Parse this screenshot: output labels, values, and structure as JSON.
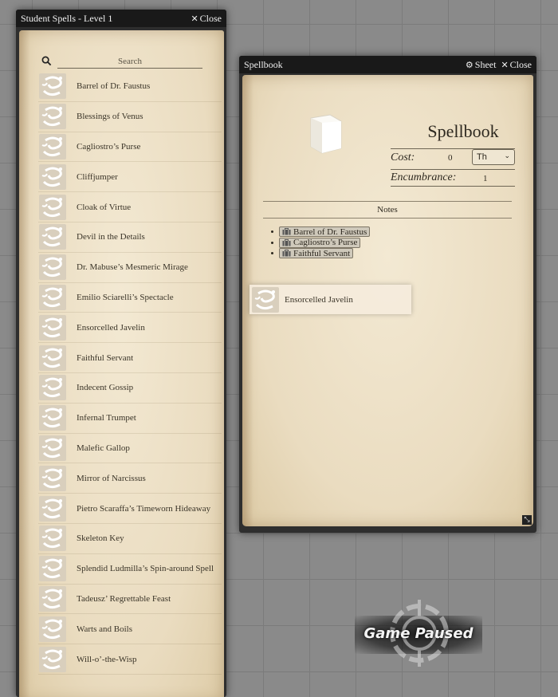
{
  "spells_window": {
    "title": "Student Spells - Level 1",
    "close_label": "Close",
    "search_placeholder": "Search",
    "spells": [
      "Barrel of Dr. Faustus",
      "Blessings of Venus",
      "Cagliostro’s Purse",
      "Cliffjumper",
      "Cloak of Virtue",
      "Devil in the Details",
      "Dr. Mabuse’s Mesmeric Mirage",
      "Emilio Sciarelli’s Spectacle",
      "Ensorcelled Javelin",
      "Faithful Servant",
      "Indecent Gossip",
      "Infernal Trumpet",
      "Malefic Gallop",
      "Mirror of Narcissus",
      "Pietro Scaraffa’s Timeworn Hideaway",
      "Skeleton Key",
      "Splendid Ludmilla’s Spin-around Spell",
      "Tadeusz’ Regrettable Feast",
      "Warts and Boils",
      "Will-o’-the-Wisp"
    ]
  },
  "spellbook_window": {
    "title": "Spellbook",
    "sheet_label": "Sheet",
    "close_label": "Close",
    "item_name": "Spellbook",
    "cost_label": "Cost:",
    "cost_value": "0",
    "cost_unit": "Th",
    "encumbrance_label": "Encumbrance:",
    "encumbrance_value": "1",
    "notes_label": "Notes",
    "notes_items": [
      "Barrel of Dr. Faustus",
      "Cagliostro’s Purse",
      "Faithful Servant"
    ]
  },
  "drag_ghost": {
    "label": "Ensorcelled Javelin"
  },
  "status": {
    "paused_text": "Game Paused"
  },
  "colors": {
    "window_header": "#191919",
    "parchment": "#eadcc0",
    "text": "#3a3428"
  }
}
